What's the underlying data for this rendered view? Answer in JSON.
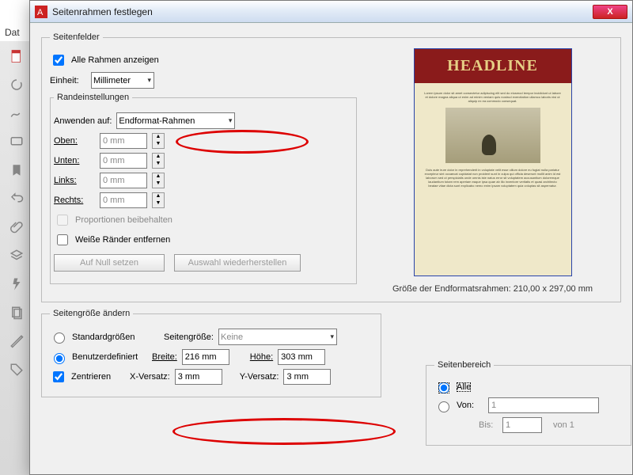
{
  "app": {
    "menu_hint": "Dat",
    "title_prefix": "A"
  },
  "dialog": {
    "title": "Seitenrahmen festlegen",
    "close": "X"
  },
  "fields": {
    "legend": "Seitenfelder",
    "show_all": "Alle Rahmen anzeigen",
    "unit_label": "Einheit:",
    "unit_value": "Millimeter"
  },
  "margins": {
    "legend": "Randeinstellungen",
    "apply_label": "Anwenden auf:",
    "apply_value": "Endformat-Rahmen",
    "top_l": "Oben:",
    "top_v": "0 mm",
    "bottom_l": "Unten:",
    "bottom_v": "0 mm",
    "left_l": "Links:",
    "left_v": "0 mm",
    "right_l": "Rechts:",
    "right_v": "0 mm",
    "constrain": "Proportionen beibehalten",
    "remove_white": "Weiße Ränder entfernen",
    "reset": "Auf Null setzen",
    "revert": "Auswahl wiederherstellen"
  },
  "preview": {
    "headline": "HEADLINE",
    "caption": "Größe der Endformatsrahmen: 210,00 x 297,00 mm"
  },
  "size": {
    "legend": "Seitengröße ändern",
    "std_label": "Standardgrößen",
    "page_size_l": "Seitengröße:",
    "page_size_v": "Keine",
    "custom_label": "Benutzerdefiniert",
    "width_l": "Breite:",
    "width_v": "216 mm",
    "height_l": "Höhe:",
    "height_v": "303 mm",
    "center": "Zentrieren",
    "xoff_l": "X-Versatz:",
    "xoff_v": "3 mm",
    "yoff_l": "Y-Versatz:",
    "yoff_v": "3 mm"
  },
  "range": {
    "legend": "Seitenbereich",
    "all": "Alle",
    "from": "Von:",
    "from_v": "1",
    "to": "Bis:",
    "to_v": "1",
    "of": "von 1"
  }
}
